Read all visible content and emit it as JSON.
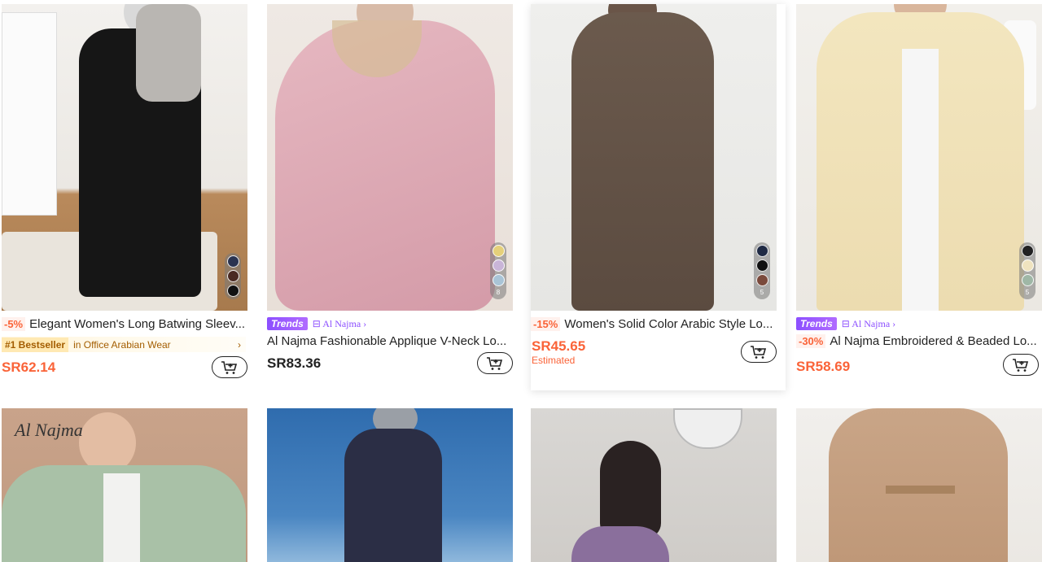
{
  "row1": [
    {
      "discount": "-5%",
      "title": "Elegant Women's Long Batwing Sleev...",
      "bestseller_rank": "#1 Bestseller",
      "bestseller_category": "in Office Arabian Wear",
      "bestseller_chevron": "›",
      "price": "SR62.14",
      "swatches": [
        "#2a3350",
        "#4a2a22",
        "#111111"
      ],
      "swatch_count": ""
    },
    {
      "trend_tag": "Trends",
      "brand": "⊟ Al Najma ›",
      "title": "Al Najma Fashionable Applique V-Neck Lo...",
      "price": "SR83.36",
      "swatches": [
        "#e5d07a",
        "#c9b5d8",
        "#a9c4d6"
      ],
      "swatch_count": "8"
    },
    {
      "discount": "-15%",
      "title": "Women's Solid Color Arabic Style Lo...",
      "price": "SR45.65",
      "estimated": "Estimated",
      "swatches": [
        "#1f2a44",
        "#111111",
        "#7a4a3c"
      ],
      "swatch_count": "5"
    },
    {
      "trend_tag": "Trends",
      "brand": "⊟ Al Najma ›",
      "discount": "-30%",
      "title": "Al Najma Embroidered & Beaded Lo...",
      "price": "SR58.69",
      "swatches": [
        "#222222",
        "#efe3bf",
        "#9fb7a6"
      ],
      "swatch_count": "5"
    }
  ],
  "image_watermark": "Al Najma",
  "colors": {
    "accent": "#fa6338",
    "trend_purple": "#8c4fff",
    "bestseller_brown": "#a35d00"
  },
  "icons": {
    "cart": "add-to-cart-icon"
  }
}
